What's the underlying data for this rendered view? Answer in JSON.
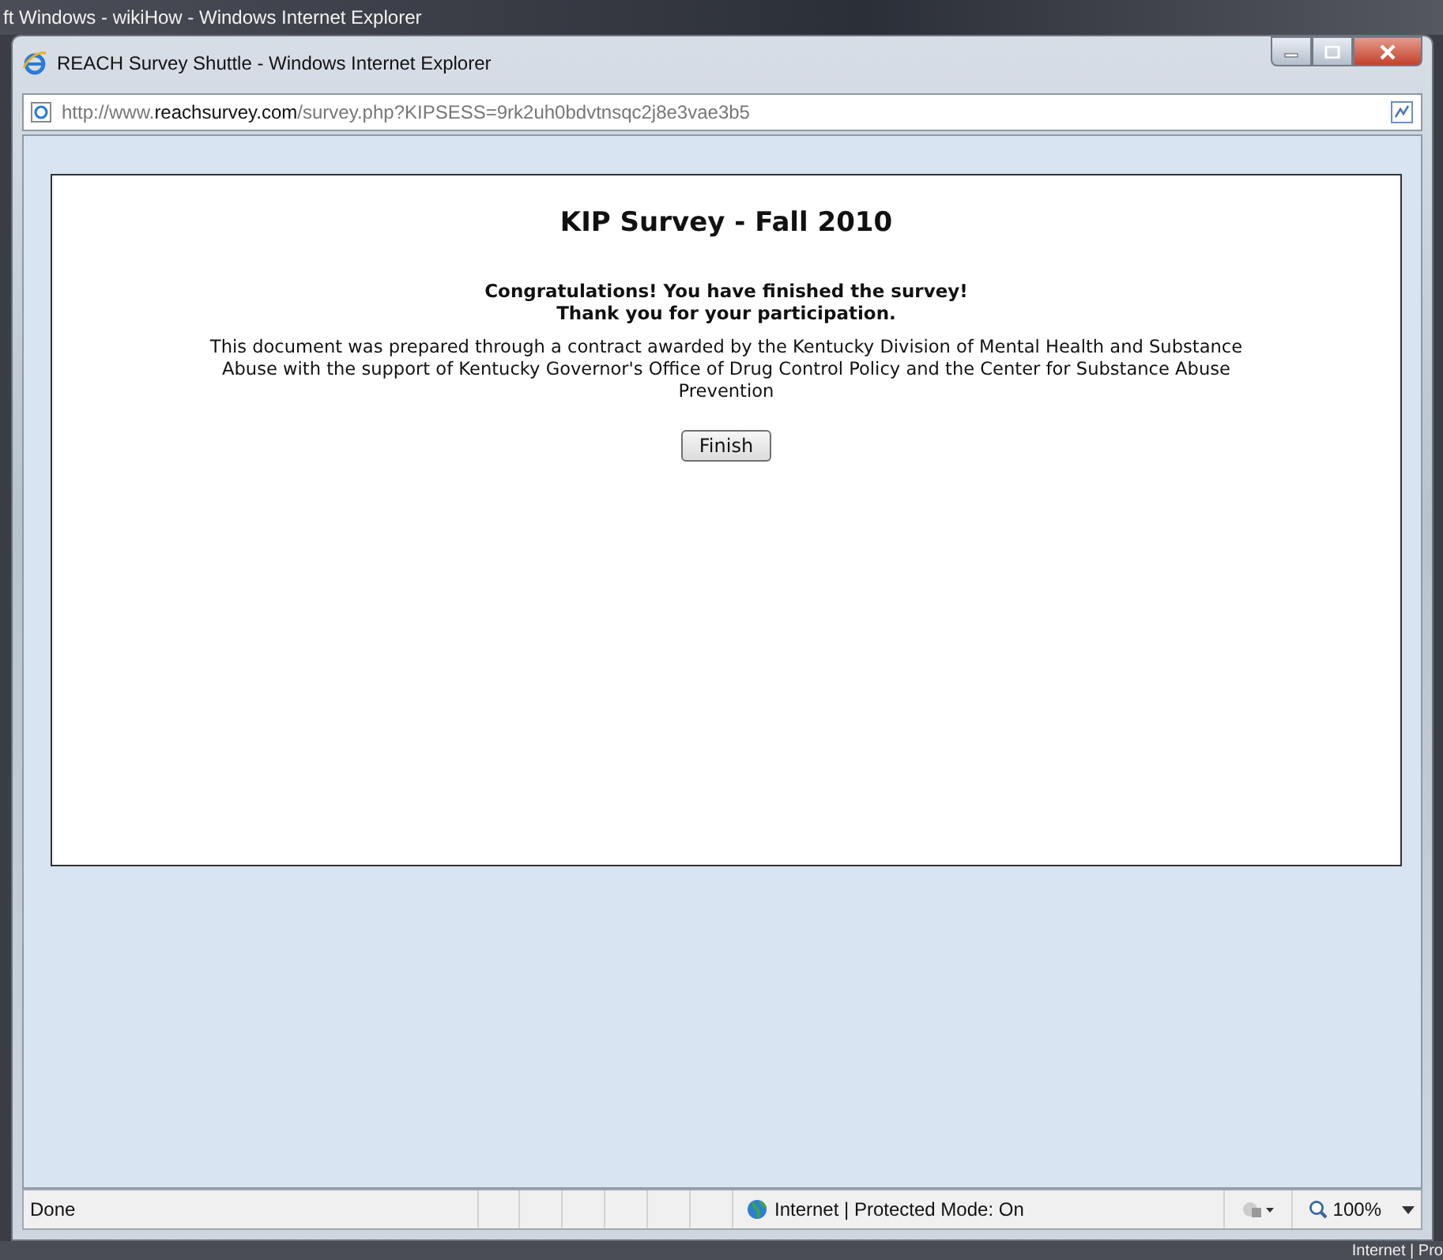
{
  "background_window": {
    "title": "ft Windows - wikiHow - Windows Internet Explorer",
    "status_text": "Internet | Pro"
  },
  "window": {
    "title": "REACH Survey Shuttle - Windows Internet Explorer",
    "address": "http://www.**reachsurvey.com**/survey.php?KIPSESS=9rk2uh0bdvtnsqc2j8e3vae3b5"
  },
  "page": {
    "heading": "KIP Survey - Fall 2010",
    "message_lines": [
      "Congratulations! You have finished the survey!",
      "Thank you for your participation."
    ],
    "note": "This document was prepared through a contract awarded by the Kentucky Division of Mental Health and Substance Abuse with the support of Kentucky Governor's Office of Drug Control Policy and the Center for Substance Abuse Prevention",
    "button": "Finish"
  },
  "status_bar": {
    "status": "Done",
    "zone": "Internet | Protected Mode: On",
    "zoom": "100%"
  }
}
